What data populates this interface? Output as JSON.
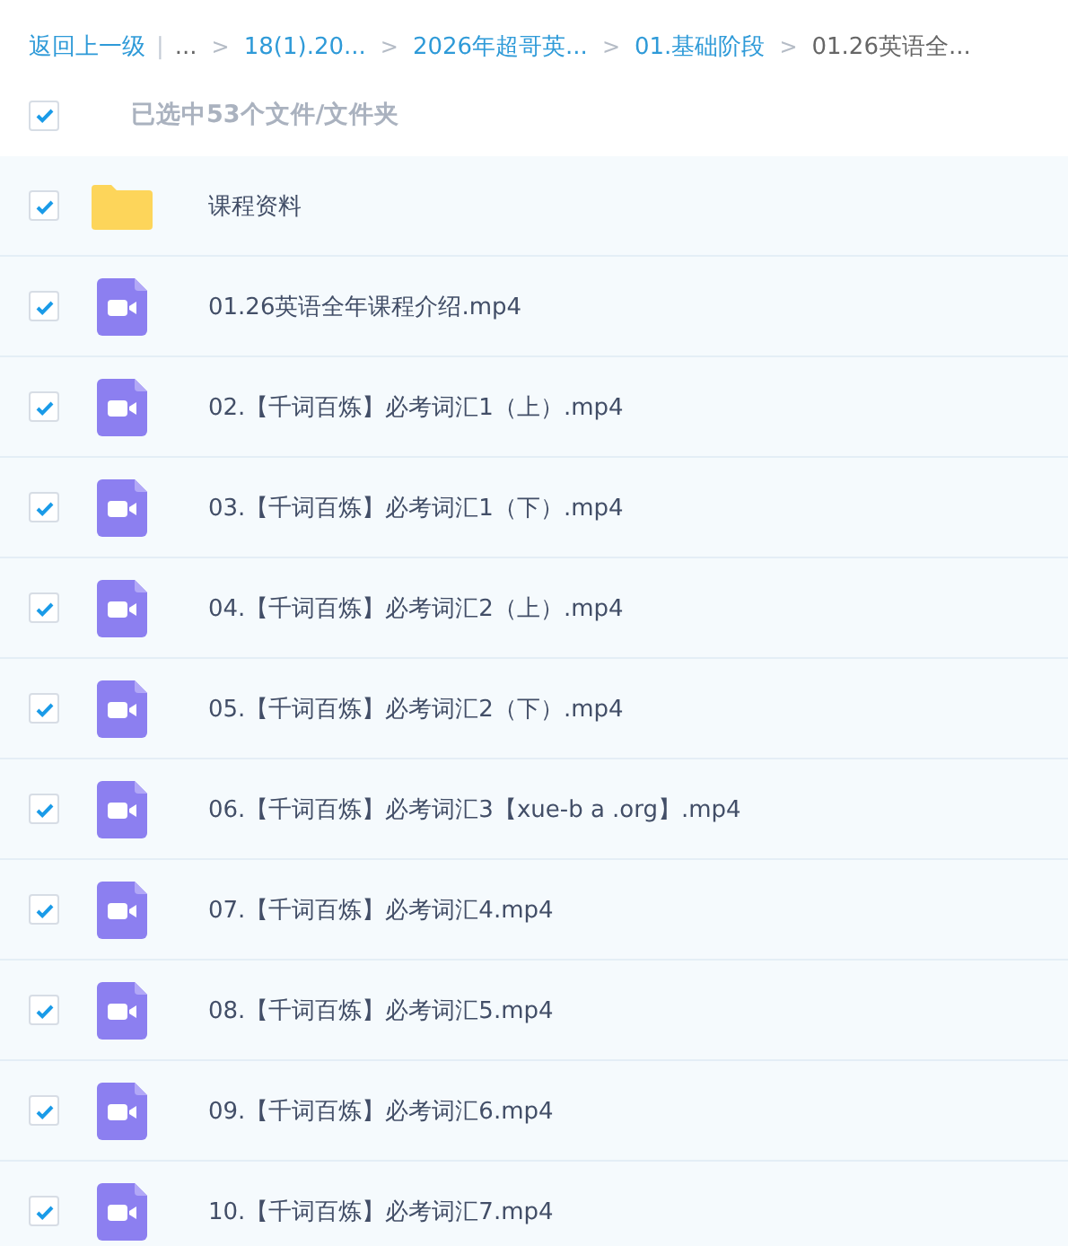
{
  "breadcrumb": {
    "back": "返回上一级",
    "divider": "|",
    "crumbs": [
      {
        "label": "...",
        "link": false
      },
      {
        "sep": ">",
        "label": "18(1).20...",
        "link": true
      },
      {
        "sep": ">",
        "label": "2026年超哥英...",
        "link": true
      },
      {
        "sep": ">",
        "label": "01.基础阶段",
        "link": true
      },
      {
        "sep": ">",
        "label": "01.26英语全...",
        "link": false
      }
    ]
  },
  "selection": {
    "checked": true,
    "label": "已选中53个文件/文件夹"
  },
  "files": [
    {
      "kind": "folder",
      "name": "课程资料",
      "checked": true
    },
    {
      "kind": "video",
      "name": "01.26英语全年课程介绍.mp4",
      "checked": true
    },
    {
      "kind": "video",
      "name": "02.【千词百炼】必考词汇1（上）.mp4",
      "checked": true
    },
    {
      "kind": "video",
      "name": "03.【千词百炼】必考词汇1（下）.mp4",
      "checked": true
    },
    {
      "kind": "video",
      "name": "04.【千词百炼】必考词汇2（上）.mp4",
      "checked": true
    },
    {
      "kind": "video",
      "name": "05.【千词百炼】必考词汇2（下）.mp4",
      "checked": true
    },
    {
      "kind": "video",
      "name": "06.【千词百炼】必考词汇3【xue-b a .org】.mp4",
      "checked": true
    },
    {
      "kind": "video",
      "name": "07.【千词百炼】必考词汇4.mp4",
      "checked": true
    },
    {
      "kind": "video",
      "name": "08.【千词百炼】必考词汇5.mp4",
      "checked": true
    },
    {
      "kind": "video",
      "name": "09.【千词百炼】必考词汇6.mp4",
      "checked": true
    },
    {
      "kind": "video",
      "name": "10.【千词百炼】必考词汇7.mp4",
      "checked": true
    }
  ]
}
